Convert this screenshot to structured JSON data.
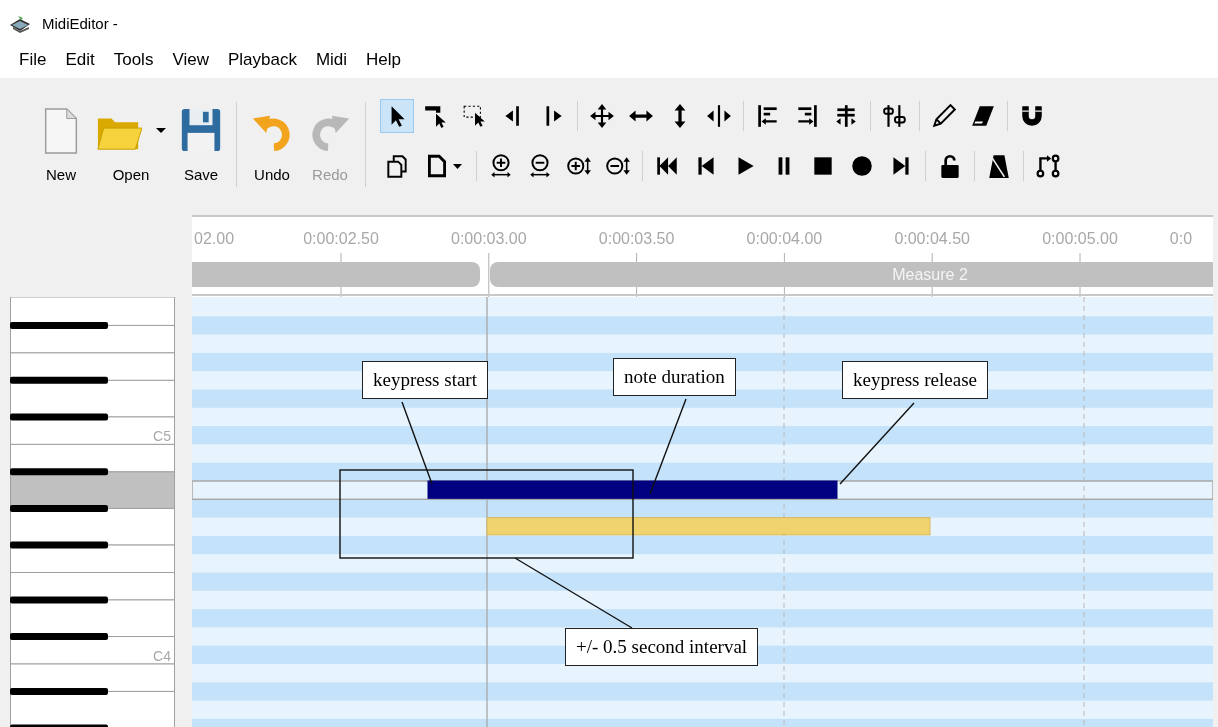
{
  "window": {
    "title": "MidiEditor -"
  },
  "menu": [
    "File",
    "Edit",
    "Tools",
    "View",
    "Playback",
    "Midi",
    "Help"
  ],
  "toolbar": {
    "large_buttons": [
      {
        "kind": "new",
        "label": "New",
        "disabled": false,
        "dropdown": false
      },
      {
        "kind": "open",
        "label": "Open",
        "disabled": false,
        "dropdown": true
      },
      {
        "kind": "save",
        "label": "Save",
        "disabled": false,
        "dropdown": false
      },
      {
        "kind": "separator"
      },
      {
        "kind": "undo",
        "label": "Undo",
        "disabled": false,
        "dropdown": false
      },
      {
        "kind": "redo",
        "label": "Redo",
        "disabled": true,
        "dropdown": false
      }
    ],
    "tools_row_1": [
      {
        "kind": "select",
        "selected": true
      },
      {
        "kind": "select-single",
        "selected": false
      },
      {
        "kind": "box-select",
        "selected": false
      },
      {
        "kind": "select-left",
        "selected": false
      },
      {
        "kind": "select-right",
        "selected": false
      },
      {
        "kind": "separator"
      },
      {
        "kind": "move-all",
        "selected": false
      },
      {
        "kind": "move-lr",
        "selected": false
      },
      {
        "kind": "move-ud",
        "selected": false
      },
      {
        "kind": "resize-lr",
        "selected": false
      },
      {
        "kind": "separator"
      },
      {
        "kind": "align-left",
        "selected": false
      },
      {
        "kind": "align-right",
        "selected": false
      },
      {
        "kind": "equalize",
        "selected": false
      },
      {
        "kind": "separator"
      },
      {
        "kind": "quantize",
        "selected": false
      },
      {
        "kind": "separator"
      },
      {
        "kind": "pencil",
        "selected": false
      },
      {
        "kind": "eraser",
        "selected": false
      },
      {
        "kind": "separator"
      },
      {
        "kind": "magnet",
        "selected": false
      }
    ],
    "tools_row_2": [
      {
        "kind": "copy",
        "dropdown": false
      },
      {
        "kind": "paste",
        "dropdown": true
      },
      {
        "kind": "separator"
      },
      {
        "kind": "zoom-in-h",
        "dropdown": false
      },
      {
        "kind": "zoom-out-h",
        "dropdown": false
      },
      {
        "kind": "zoom-in-v",
        "dropdown": false
      },
      {
        "kind": "zoom-out-v",
        "dropdown": false
      },
      {
        "kind": "separator"
      },
      {
        "kind": "skip-start",
        "dropdown": false
      },
      {
        "kind": "step-back",
        "dropdown": false
      },
      {
        "kind": "play",
        "dropdown": false
      },
      {
        "kind": "pause",
        "dropdown": false
      },
      {
        "kind": "stop",
        "dropdown": false
      },
      {
        "kind": "record",
        "dropdown": false
      },
      {
        "kind": "step-forward",
        "dropdown": false
      },
      {
        "kind": "separator"
      },
      {
        "kind": "unlock",
        "dropdown": false
      },
      {
        "kind": "separator"
      },
      {
        "kind": "metronome",
        "dropdown": false
      },
      {
        "kind": "separator"
      },
      {
        "kind": "connect",
        "dropdown": false
      }
    ]
  },
  "ruler": {
    "time_labels": [
      "02.00",
      "0:00:02.50",
      "0:00:03.00",
      "0:00:03.50",
      "0:00:04.00",
      "0:00:04.50",
      "0:00:05.00",
      "0:0"
    ],
    "measure_label": "Measure 2"
  },
  "piano": {
    "keys": [
      {
        "kind": "white",
        "selected": false
      },
      {
        "kind": "black",
        "selected": false
      },
      {
        "kind": "white",
        "selected": false
      },
      {
        "kind": "white",
        "selected": false
      },
      {
        "kind": "black",
        "selected": false
      },
      {
        "kind": "white",
        "selected": false
      },
      {
        "kind": "black",
        "selected": false
      },
      {
        "kind": "white",
        "selected": false,
        "label": "C5"
      },
      {
        "kind": "white",
        "selected": false
      },
      {
        "kind": "black",
        "selected": false
      },
      {
        "kind": "white",
        "selected": true
      },
      {
        "kind": "black",
        "selected": false
      },
      {
        "kind": "white",
        "selected": false
      },
      {
        "kind": "black",
        "selected": false
      },
      {
        "kind": "white",
        "selected": false
      },
      {
        "kind": "white",
        "selected": false
      },
      {
        "kind": "black",
        "selected": false
      },
      {
        "kind": "white",
        "selected": false
      },
      {
        "kind": "black",
        "selected": false
      },
      {
        "kind": "white",
        "selected": false,
        "label": "C4"
      },
      {
        "kind": "white",
        "selected": false
      },
      {
        "kind": "black",
        "selected": false
      },
      {
        "kind": "white",
        "selected": false
      },
      {
        "kind": "black",
        "selected": false
      }
    ]
  },
  "notes": [
    {
      "color": "#000080"
    },
    {
      "color": "#f0d36e"
    }
  ],
  "annotations": [
    {
      "text": "keypress start"
    },
    {
      "text": "note duration"
    },
    {
      "text": "keypress release"
    },
    {
      "text": "+/- 0.5 second interval"
    }
  ]
}
